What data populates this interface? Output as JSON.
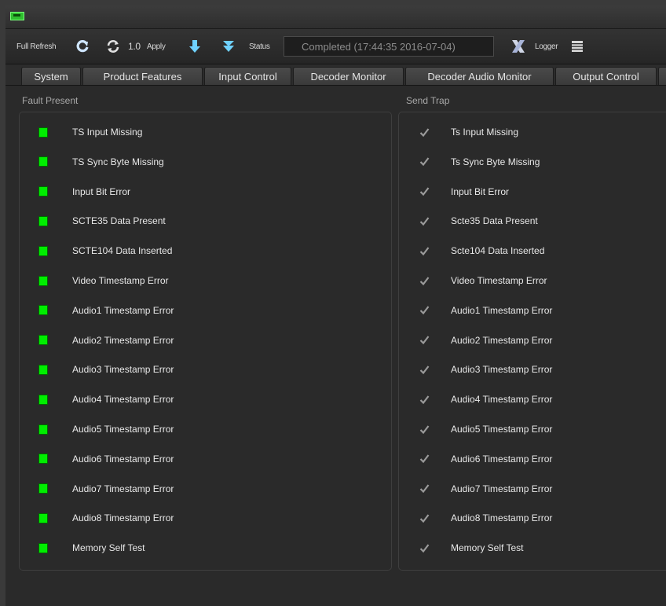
{
  "toolbar": {
    "full_refresh_label": "Full Refresh",
    "version_label": "1.0",
    "apply_label": "Apply",
    "status_label": "Status",
    "status_value": "Completed  (17:44:35  2016-07-04)",
    "logger_label": "Logger",
    "icons": [
      "refresh-icon",
      "sync-icon",
      "download-arrow-icon",
      "double-download-arrow-icon",
      "close-x-icon",
      "logger-list-icon"
    ]
  },
  "tabs": [
    {
      "label": "System"
    },
    {
      "label": "Product Features"
    },
    {
      "label": "Input Control"
    },
    {
      "label": "Decoder Monitor"
    },
    {
      "label": "Decoder Audio Monitor"
    },
    {
      "label": "Output Control"
    }
  ],
  "fault_present": {
    "title": "Fault Present",
    "led_color": "#00ee00",
    "items": [
      {
        "label": "TS Input Missing"
      },
      {
        "label": "TS Sync Byte Missing"
      },
      {
        "label": "Input Bit Error"
      },
      {
        "label": "SCTE35 Data Present"
      },
      {
        "label": "SCTE104 Data Inserted"
      },
      {
        "label": "Video Timestamp Error"
      },
      {
        "label": "Audio1 Timestamp Error"
      },
      {
        "label": "Audio2 Timestamp Error"
      },
      {
        "label": "Audio3 Timestamp Error"
      },
      {
        "label": "Audio4 Timestamp Error"
      },
      {
        "label": "Audio5 Timestamp Error"
      },
      {
        "label": "Audio6 Timestamp Error"
      },
      {
        "label": "Audio7 Timestamp Error"
      },
      {
        "label": "Audio8 Timestamp Error"
      },
      {
        "label": "Memory Self Test"
      }
    ]
  },
  "send_trap": {
    "title": "Send Trap",
    "items": [
      {
        "label": "Ts Input Missing",
        "checked": true
      },
      {
        "label": "Ts Sync Byte Missing",
        "checked": true
      },
      {
        "label": "Input Bit Error",
        "checked": true
      },
      {
        "label": "Scte35 Data Present",
        "checked": true
      },
      {
        "label": "Scte104 Data Inserted",
        "checked": true
      },
      {
        "label": "Video Timestamp Error",
        "checked": true
      },
      {
        "label": "Audio1 Timestamp Error",
        "checked": true
      },
      {
        "label": "Audio2 Timestamp Error",
        "checked": true
      },
      {
        "label": "Audio3 Timestamp Error",
        "checked": true
      },
      {
        "label": "Audio4 Timestamp Error",
        "checked": true
      },
      {
        "label": "Audio5 Timestamp Error",
        "checked": true
      },
      {
        "label": "Audio6 Timestamp Error",
        "checked": true
      },
      {
        "label": "Audio7 Timestamp Error",
        "checked": true
      },
      {
        "label": "Audio8 Timestamp Error",
        "checked": true
      },
      {
        "label": "Memory Self Test",
        "checked": true
      }
    ]
  }
}
